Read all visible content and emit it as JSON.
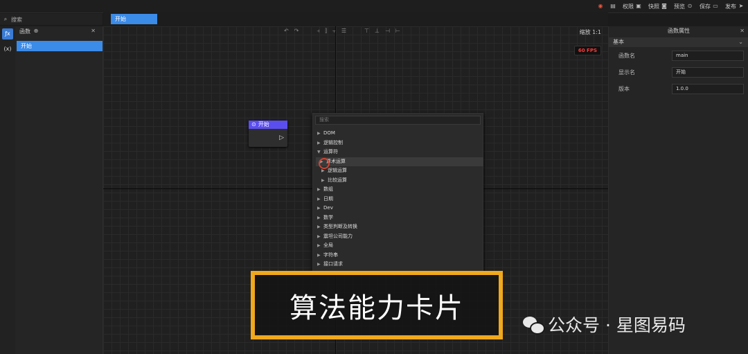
{
  "top_actions": [
    {
      "label": "",
      "icon": "logo-icon"
    },
    {
      "label": "",
      "icon": "doc-icon"
    },
    {
      "label": "权限",
      "icon": "lock-icon"
    },
    {
      "label": "快照",
      "icon": "camera-icon"
    },
    {
      "label": "预览",
      "icon": "play-icon"
    },
    {
      "label": "保存",
      "icon": "save-icon"
    },
    {
      "label": "发布",
      "icon": "send-icon"
    }
  ],
  "search": {
    "placeholder": "搜索"
  },
  "rail": {
    "fx": "ƒx",
    "var": "(x)"
  },
  "left_panel": {
    "title": "函数",
    "items": [
      "开始"
    ]
  },
  "tab": {
    "label": "开始"
  },
  "toolbar": {
    "zoom": "缩放 1:1",
    "fps": "60 FPS"
  },
  "node": {
    "title": "开始"
  },
  "popup": {
    "search_placeholder": "搜索",
    "items": [
      {
        "label": "DOM",
        "arrow": "▶",
        "indent": 0
      },
      {
        "label": "逻辑控制",
        "arrow": "▶",
        "indent": 0
      },
      {
        "label": "运算符",
        "arrow": "▼",
        "indent": 0
      },
      {
        "label": "算术运算",
        "arrow": "▶",
        "indent": 1
      },
      {
        "label": "逻辑运算",
        "arrow": "▶",
        "indent": 1
      },
      {
        "label": "比较运算",
        "arrow": "▶",
        "indent": 1
      },
      {
        "label": "数组",
        "arrow": "▶",
        "indent": 0
      },
      {
        "label": "日期",
        "arrow": "▶",
        "indent": 0
      },
      {
        "label": "Dev",
        "arrow": "▶",
        "indent": 0
      },
      {
        "label": "数学",
        "arrow": "▶",
        "indent": 0
      },
      {
        "label": "类型判断及转换",
        "arrow": "▶",
        "indent": 0
      },
      {
        "label": "震坦公司能力",
        "arrow": "▶",
        "indent": 0
      },
      {
        "label": "全局",
        "arrow": "▶",
        "indent": 0
      },
      {
        "label": "字符串",
        "arrow": "▶",
        "indent": 0
      },
      {
        "label": "接口请求",
        "arrow": "▶",
        "indent": 0
      }
    ]
  },
  "right_panel": {
    "title": "函数属性",
    "section": "基本",
    "fields": [
      {
        "label": "函数名",
        "value": "main"
      },
      {
        "label": "显示名",
        "value": "开始"
      },
      {
        "label": "版本",
        "value": "1.0.0"
      }
    ]
  },
  "caption": "算法能力卡片",
  "watermark": "公众号 · 星图易码",
  "colors": {
    "accent": "#3b8be8",
    "node_header": "#5b4ef0",
    "caption_border": "#f0a81c",
    "fps": "#ff3b3b"
  }
}
